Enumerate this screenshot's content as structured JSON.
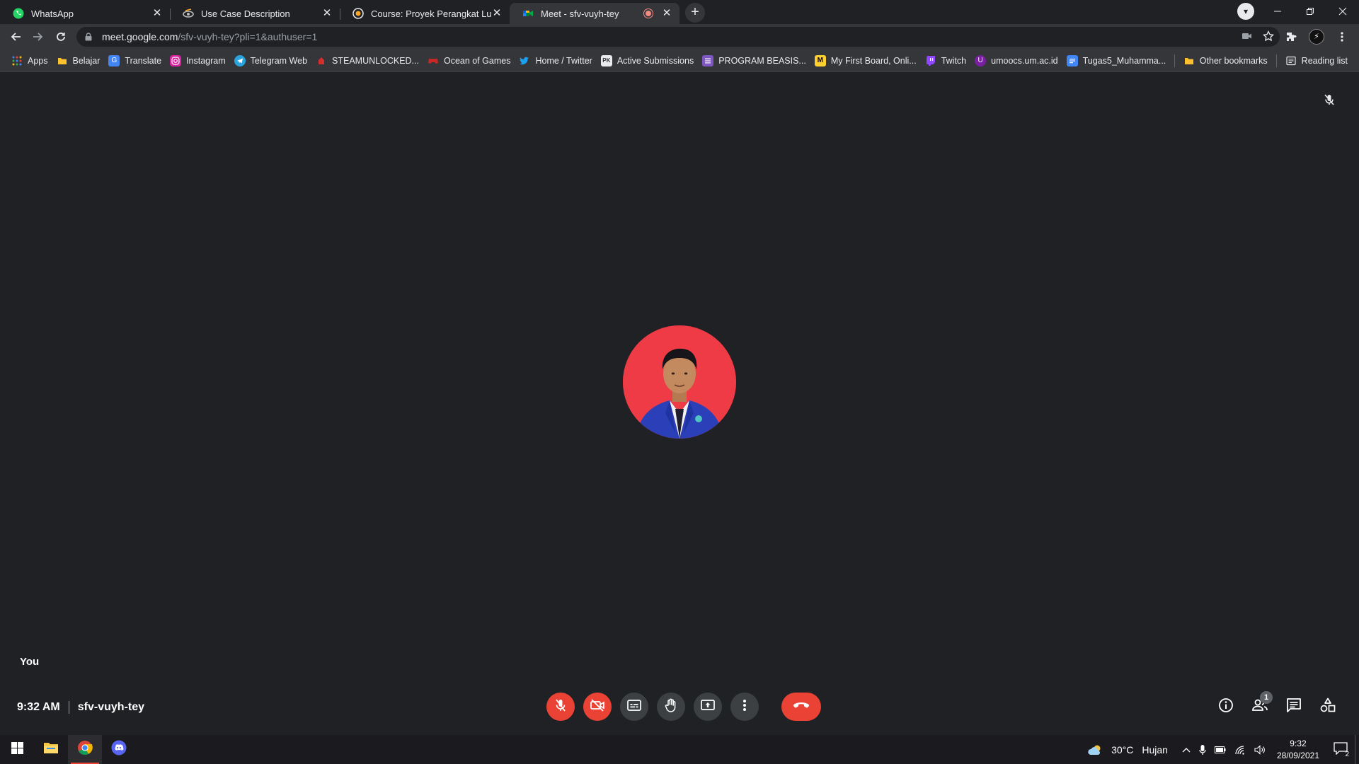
{
  "browser": {
    "tabs": [
      {
        "title": "WhatsApp",
        "icon": "whatsapp-icon",
        "active": false
      },
      {
        "title": "Use Case Description",
        "icon": "site-icon",
        "active": false
      },
      {
        "title": "Course: Proyek Perangkat Lunak",
        "icon": "moodle-icon",
        "active": false
      },
      {
        "title": "Meet - sfv-vuyh-tey",
        "icon": "meet-icon",
        "active": true
      }
    ],
    "new_tab_label": "+",
    "url_host": "meet.google.com",
    "url_path": "/sfv-vuyh-tey?pli=1&authuser=1",
    "bookmarks": [
      {
        "label": "Apps",
        "icon": "apps-grid-icon",
        "color": "#4285f4"
      },
      {
        "label": "Belajar",
        "icon": "folder-icon",
        "color": "#fbc02d"
      },
      {
        "label": "Translate",
        "icon": "translate-icon",
        "color": "#4285f4"
      },
      {
        "label": "Instagram",
        "icon": "instagram-icon",
        "color": "#d6249f"
      },
      {
        "label": "Telegram Web",
        "icon": "telegram-icon",
        "color": "#2aa3df"
      },
      {
        "label": "STEAMUNLOCKED...",
        "icon": "steamunlocked-icon",
        "color": "#d32f2f"
      },
      {
        "label": "Ocean of Games",
        "icon": "ocean-of-games-icon",
        "color": "#c62828"
      },
      {
        "label": "Home / Twitter",
        "icon": "twitter-icon",
        "color": "#1da1f2"
      },
      {
        "label": "Active Submissions",
        "icon": "submissions-icon",
        "color": "#666666"
      },
      {
        "label": "PROGRAM BEASIS...",
        "icon": "forms-icon",
        "color": "#7e57c2"
      },
      {
        "label": "My First Board, Onli...",
        "icon": "miro-icon",
        "color": "#ffd02f"
      },
      {
        "label": "Twitch",
        "icon": "twitch-icon",
        "color": "#9146ff"
      },
      {
        "label": "umoocs.um.ac.id",
        "icon": "umoocs-icon",
        "color": "#7b1fa2"
      },
      {
        "label": "Tugas5_Muhamma...",
        "icon": "docs-icon",
        "color": "#4285f4"
      }
    ],
    "other_bookmarks": "Other bookmarks",
    "reading_list": "Reading list"
  },
  "meet": {
    "self_label": "You",
    "time": "9:32 AM",
    "meeting_code": "sfv-vuyh-tey",
    "participant_count": "1",
    "colors": {
      "danger": "#ea4335",
      "surface": "#3c4043",
      "background": "#202124"
    }
  },
  "taskbar": {
    "weather": "30°C",
    "weather_desc": "Hujan",
    "clock_time": "9:32",
    "clock_date": "28/09/2021",
    "notifications": "2"
  }
}
